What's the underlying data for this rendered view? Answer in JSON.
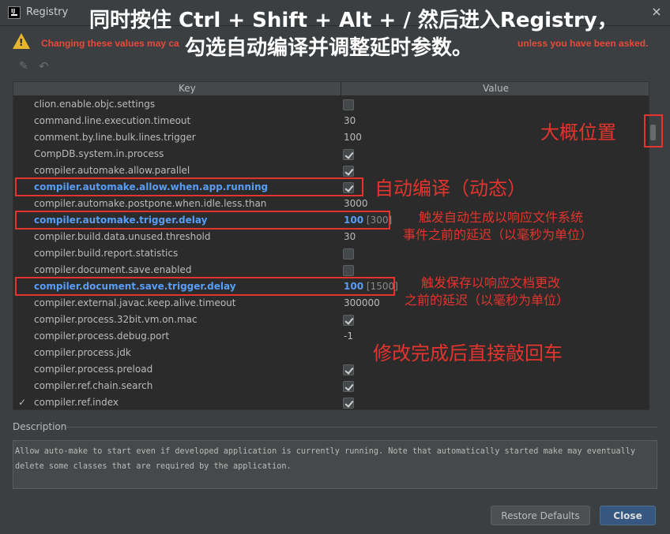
{
  "window": {
    "title": "Registry",
    "logo_text": "IJ",
    "close_glyph": "×"
  },
  "warning": {
    "text_left": "Changing these values may ca",
    "text_right": "unless you have been asked.",
    "icon": "warning-icon",
    "color": "#e8493a"
  },
  "toolbar": {
    "edit_glyph": "✎",
    "revert_glyph": "↶"
  },
  "overlay": {
    "line1": "同时按住 Ctrl + Shift + Alt + / 然后进入Registry，",
    "line2": "勾选自动编译并调整延时参数。",
    "approx_position": "大概位置",
    "auto_compile": "自动编译（动态）",
    "trigger_delay_line1": "触发自动生成以响应文件系统",
    "trigger_delay_line2": "事件之前的延迟（以毫秒为单位）",
    "save_delay_line1": "触发保存以响应文档更改",
    "save_delay_line2": "之前的延迟（以毫秒为单位）",
    "press_enter": "修改完成后直接敲回车",
    "color": "#e5342d"
  },
  "table": {
    "col_key": "Key",
    "col_value": "Value",
    "rows": [
      {
        "key": "clion.enable.objc.settings",
        "type": "checkbox",
        "checked": false
      },
      {
        "key": "command.line.execution.timeout",
        "type": "text",
        "value": "30"
      },
      {
        "key": "comment.by.line.bulk.lines.trigger",
        "type": "text",
        "value": "100"
      },
      {
        "key": "CompDB.system.in.process",
        "type": "checkbox",
        "checked": true
      },
      {
        "key": "compiler.automake.allow.parallel",
        "type": "checkbox",
        "checked": true
      },
      {
        "key": "compiler.automake.allow.when.app.running",
        "type": "checkbox",
        "checked": true,
        "modified": true
      },
      {
        "key": "compiler.automake.postpone.when.idle.less.than",
        "type": "text",
        "value": "3000"
      },
      {
        "key": "compiler.automake.trigger.delay",
        "type": "text",
        "value": "100",
        "default": "[300]",
        "modified": true
      },
      {
        "key": "compiler.build.data.unused.threshold",
        "type": "text",
        "value": "30"
      },
      {
        "key": "compiler.build.report.statistics",
        "type": "checkbox",
        "checked": false
      },
      {
        "key": "compiler.document.save.enabled",
        "type": "checkbox",
        "checked": false
      },
      {
        "key": "compiler.document.save.trigger.delay",
        "type": "text",
        "value": "100",
        "default": "[1500]",
        "modified": true
      },
      {
        "key": "compiler.external.javac.keep.alive.timeout",
        "type": "text",
        "value": "300000"
      },
      {
        "key": "compiler.process.32bit.vm.on.mac",
        "type": "checkbox",
        "checked": true
      },
      {
        "key": "compiler.process.debug.port",
        "type": "text",
        "value": "-1"
      },
      {
        "key": "compiler.process.jdk",
        "type": "text",
        "value": ""
      },
      {
        "key": "compiler.process.preload",
        "type": "checkbox",
        "checked": true
      },
      {
        "key": "compiler.ref.chain.search",
        "type": "checkbox",
        "checked": true
      },
      {
        "key": "compiler.ref.index",
        "type": "checkbox",
        "checked": true,
        "mark": "✓"
      }
    ]
  },
  "description": {
    "label": "Description",
    "text": "Allow auto-make to start even if developed application is currently running. Note that automatically started make may eventually delete some classes that are required by the application."
  },
  "buttons": {
    "restore_defaults": "Restore Defaults",
    "close": "Close"
  },
  "colors": {
    "modified_key": "#589df6",
    "background": "#3c3f41",
    "table_bg": "#2b2b2b",
    "primary_button": "#365880"
  }
}
